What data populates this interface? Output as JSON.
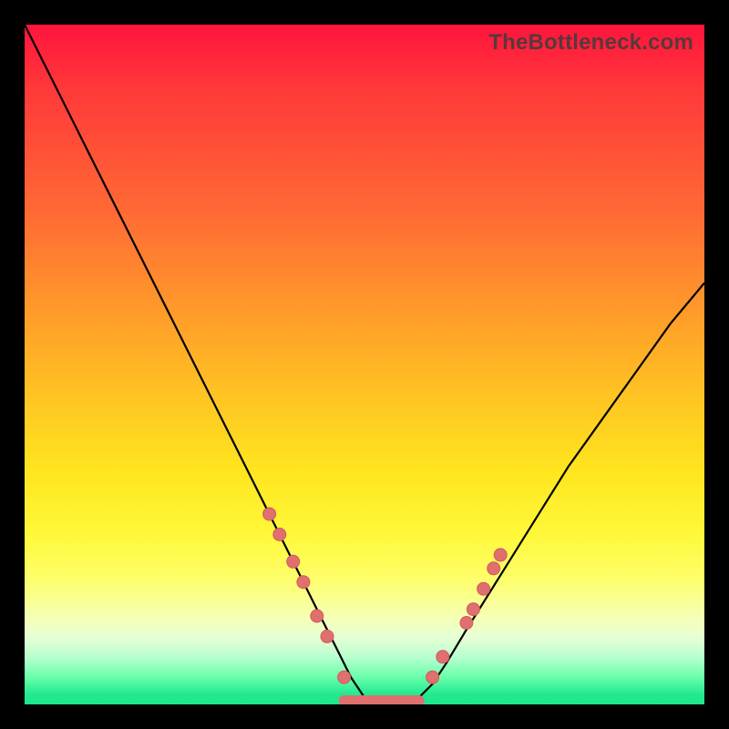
{
  "watermark": "TheBottleneck.com",
  "colors": {
    "frame": "#000000",
    "curve": "#000000",
    "marker": "#e06f6f",
    "gradient_top": "#ff143c",
    "gradient_bottom": "#1fe68c"
  },
  "chart_data": {
    "type": "line",
    "title": "",
    "xlabel": "",
    "ylabel": "",
    "xlim": [
      0,
      100
    ],
    "ylim": [
      0,
      100
    ],
    "x": [
      0,
      5,
      10,
      15,
      20,
      25,
      30,
      35,
      38,
      40,
      42,
      44,
      46,
      48,
      50,
      52,
      54,
      56,
      58,
      60,
      62,
      65,
      70,
      75,
      80,
      85,
      90,
      95,
      100
    ],
    "y": [
      100,
      90,
      80,
      70,
      60,
      50,
      40,
      30,
      24,
      20,
      16,
      12,
      8,
      4,
      1,
      0,
      0,
      0,
      1,
      3,
      6,
      11,
      19,
      27,
      35,
      42,
      49,
      56,
      62
    ],
    "flat_segment": {
      "x_start": 47,
      "x_end": 58,
      "y": 0
    },
    "markers_left": [
      {
        "x": 36.0,
        "y": 28.0
      },
      {
        "x": 37.5,
        "y": 25.0
      },
      {
        "x": 39.5,
        "y": 21.0
      },
      {
        "x": 41.0,
        "y": 18.0
      },
      {
        "x": 43.0,
        "y": 13.0
      },
      {
        "x": 44.5,
        "y": 10.0
      },
      {
        "x": 47.0,
        "y": 4.0
      }
    ],
    "markers_right": [
      {
        "x": 60.0,
        "y": 4.0
      },
      {
        "x": 61.5,
        "y": 7.0
      },
      {
        "x": 65.0,
        "y": 12.0
      },
      {
        "x": 66.0,
        "y": 14.0
      },
      {
        "x": 67.5,
        "y": 17.0
      },
      {
        "x": 69.0,
        "y": 20.0
      },
      {
        "x": 70.0,
        "y": 22.0
      }
    ]
  }
}
